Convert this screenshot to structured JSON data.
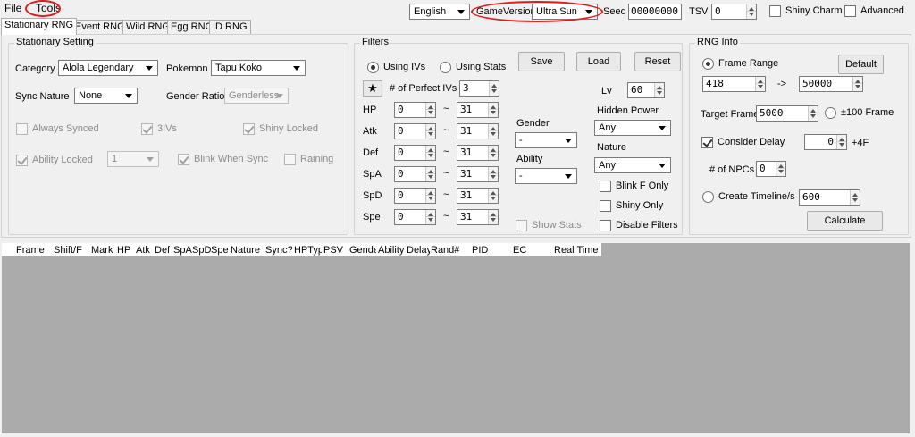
{
  "menu": {
    "file": "File",
    "tools": "Tools"
  },
  "topbar": {
    "language": "English",
    "game_version_label": "GameVersion",
    "game_version": "Ultra Sun",
    "seed_label": "Seed",
    "seed_value": "00000000",
    "tsv_label": "TSV",
    "tsv_value": "0",
    "shiny_charm": "Shiny Charm",
    "advanced": "Advanced"
  },
  "tabs": [
    "Stationary RNG",
    "Event RNG",
    "Wild RNG",
    "Egg RNG",
    "ID RNG"
  ],
  "stationary": {
    "title": "Stationary Setting",
    "category_label": "Category",
    "category_value": "Alola Legendary",
    "pokemon_label": "Pokemon",
    "pokemon_value": "Tapu Koko",
    "sync_nature_label": "Sync Nature",
    "sync_nature_value": "None",
    "gender_ratio_label": "Gender Ratio",
    "gender_ratio_value": "Genderless",
    "always_synced": "Always Synced",
    "three_ivs": "3IVs",
    "shiny_locked": "Shiny Locked",
    "ability_locked": "Ability Locked",
    "ability_value": "1",
    "blink_when_sync": "Blink When Sync",
    "raining": "Raining"
  },
  "filters": {
    "title": "Filters",
    "using_ivs": "Using IVs",
    "using_stats": "Using Stats",
    "save": "Save",
    "load": "Load",
    "reset": "Reset",
    "star": "★",
    "perfect_ivs_label": "# of Perfect IVs",
    "perfect_ivs_value": "3",
    "stats": [
      {
        "label": "HP",
        "min": "0",
        "max": "31"
      },
      {
        "label": "Atk",
        "min": "0",
        "max": "31"
      },
      {
        "label": "Def",
        "min": "0",
        "max": "31"
      },
      {
        "label": "SpA",
        "min": "0",
        "max": "31"
      },
      {
        "label": "SpD",
        "min": "0",
        "max": "31"
      },
      {
        "label": "Spe",
        "min": "0",
        "max": "31"
      }
    ],
    "tilde": "~",
    "lv_label": "Lv",
    "lv_value": "60",
    "gender_label": "Gender",
    "gender_value": "-",
    "ability_label": "Ability",
    "ability_value": "-",
    "hidden_power_label": "Hidden Power",
    "hidden_power_value": "Any",
    "nature_label": "Nature",
    "nature_value": "Any",
    "blink_f_only": "Blink F Only",
    "shiny_only": "Shiny Only",
    "show_stats": "Show Stats",
    "disable_filters": "Disable Filters"
  },
  "rng_info": {
    "title": "RNG Info",
    "frame_range": "Frame Range",
    "default": "Default",
    "range_start": "418",
    "arrow": "->",
    "range_end": "50000",
    "target_frame_label": "Target Frame",
    "target_frame_value": "5000",
    "plus_minus_100": "±100 Frame",
    "consider_delay": "Consider Delay",
    "delay_value": "0",
    "delay_suffix": "+4F",
    "npcs_label": "# of NPCs",
    "npcs_value": "0",
    "create_timeline": "Create Timeline/s",
    "timeline_value": "600",
    "calculate": "Calculate"
  },
  "grid_columns": [
    "Frame",
    "Shift/F",
    "Mark",
    "HP",
    "Atk",
    "Def",
    "SpA",
    "SpD",
    "Spe",
    "Nature",
    "Sync?",
    "HPType",
    "PSV",
    "Gender",
    "Ability",
    "Delay",
    "Rand#",
    "PID",
    "EC",
    "Real Time"
  ]
}
